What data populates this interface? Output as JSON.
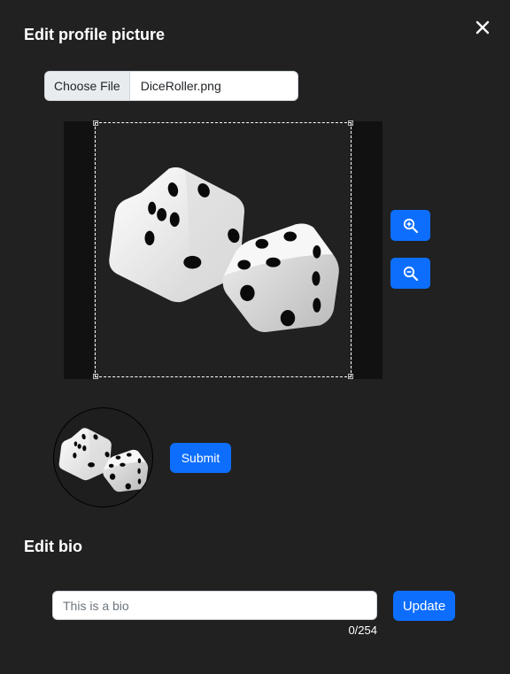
{
  "dialog": {
    "profile_title": "Edit profile picture",
    "bio_title": "Edit bio",
    "close_icon": "close-icon"
  },
  "file_input": {
    "button_label": "Choose File",
    "file_name": "DiceRoller.png"
  },
  "cropper": {
    "zoom_in_icon": "zoom-in-icon",
    "zoom_out_icon": "zoom-out-icon"
  },
  "actions": {
    "submit_label": "Submit",
    "update_label": "Update"
  },
  "bio": {
    "placeholder": "This is a bio",
    "value": "",
    "counter": "0/254"
  },
  "colors": {
    "background": "#212121",
    "primary": "#0d6efd"
  }
}
